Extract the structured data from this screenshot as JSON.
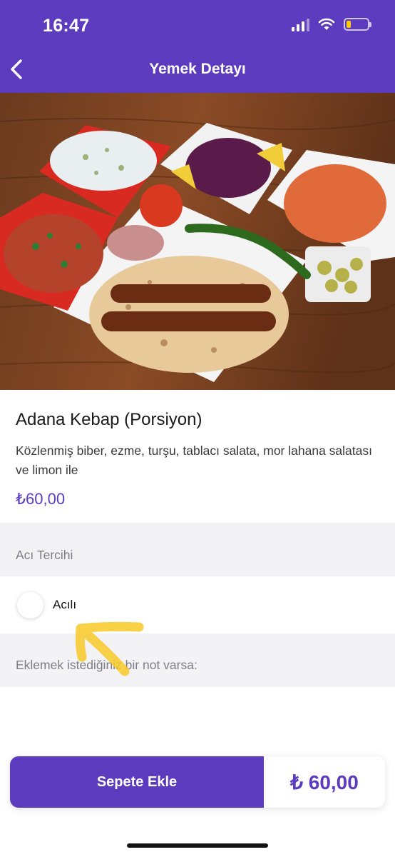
{
  "status_bar": {
    "time": "16:47"
  },
  "header": {
    "title": "Yemek Detayı",
    "back_icon": "chevron-left-icon"
  },
  "product": {
    "name": "Adana Kebap (Porsiyon)",
    "description": "Közlenmiş biber, ezme, turşu, tablacı salata, mor lahana salatası  ve limon ile",
    "price": "₺60,00"
  },
  "spice_section": {
    "title": "Acı Tercihi",
    "options": [
      {
        "label": "Acılı",
        "selected": false
      }
    ]
  },
  "note_section": {
    "title": "Eklemek istediğiniz bir not varsa:",
    "value": ""
  },
  "cart": {
    "button_label": "Sepete Ekle",
    "total": "₺ 60,00"
  },
  "colors": {
    "brand": "#5c3bbf",
    "accent": "#ffcc00",
    "background": "#f3f3f5"
  }
}
